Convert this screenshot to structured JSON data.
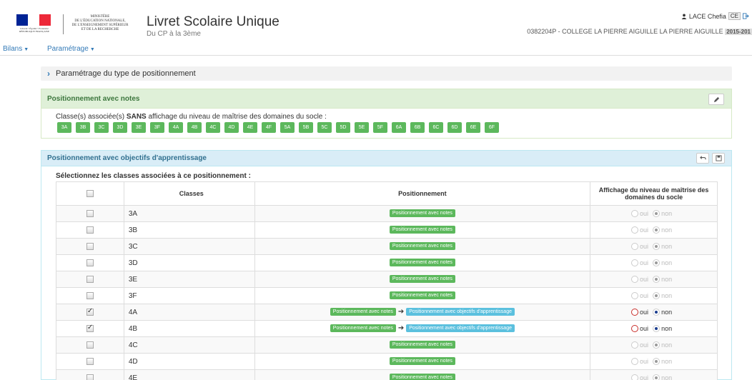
{
  "header": {
    "ministry": [
      "MINISTÈRE",
      "DE L'ÉDUCATION NATIONALE,",
      "DE L'ENSEIGNEMENT SUPÉRIEUR",
      "ET DE LA RECHERCHE"
    ],
    "republic_caption": [
      "Liberté • Égalité • Fraternité",
      "RÉPUBLIQUE FRANÇAISE"
    ],
    "flag_colors": [
      "#002395",
      "#ffffff",
      "#ed2939"
    ],
    "app_title": "Livret Scolaire Unique",
    "app_subtitle": "Du CP à la 3ème",
    "user_name": "LACE Chefia",
    "user_badge": "CE",
    "school": "0382204P - COLLEGE LA PIERRE AIGUILLE LA PIERRE AIGUILLE",
    "year": "2015-201"
  },
  "nav": {
    "bilans": "Bilans",
    "parametrage": "Paramétrage"
  },
  "collapsed_section": {
    "label": "Paramétrage du type de positionnement"
  },
  "notes_panel": {
    "title": "Positionnement avec notes",
    "note_prefix": "Classe(s) associée(s) ",
    "note_bold": "SANS",
    "note_suffix": " affichage du niveau de maîtrise des domaines du socle :",
    "classes": [
      "3A",
      "3B",
      "3C",
      "3D",
      "3E",
      "3F",
      "4A",
      "4B",
      "4C",
      "4D",
      "4E",
      "4F",
      "5A",
      "5B",
      "5C",
      "5D",
      "5E",
      "5F",
      "6A",
      "6B",
      "6C",
      "6D",
      "6E",
      "6F"
    ]
  },
  "objectives_panel": {
    "title": "Positionnement avec objectifs d'apprentissage",
    "select_note": "Sélectionnez les classes associées à ce positionnement :",
    "columns": {
      "classes": "Classes",
      "positionnement": "Positionnement",
      "affichage": "Affichage du niveau de maîtrise des domaines du socle"
    },
    "tag_notes": "Positionnement avec notes",
    "tag_objectives": "Positionnement avec objectifs d'apprentissage",
    "radio_oui": "oui",
    "radio_non": "non",
    "rows": [
      {
        "cls": "3A",
        "checked": false
      },
      {
        "cls": "3B",
        "checked": false
      },
      {
        "cls": "3C",
        "checked": false
      },
      {
        "cls": "3D",
        "checked": false
      },
      {
        "cls": "3E",
        "checked": false
      },
      {
        "cls": "3F",
        "checked": false
      },
      {
        "cls": "4A",
        "checked": true
      },
      {
        "cls": "4B",
        "checked": true
      },
      {
        "cls": "4C",
        "checked": false
      },
      {
        "cls": "4D",
        "checked": false
      },
      {
        "cls": "4E",
        "checked": false
      }
    ]
  }
}
